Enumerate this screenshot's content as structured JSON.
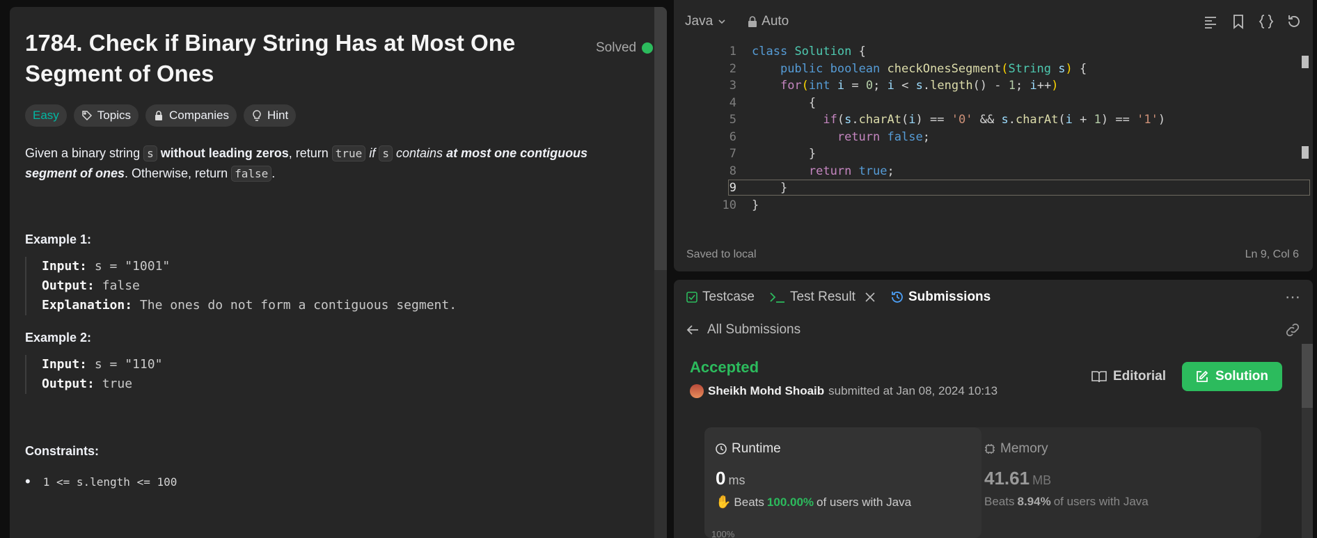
{
  "problem": {
    "title": "1784. Check if Binary String Has at Most One Segment of Ones",
    "status": "Solved",
    "tags": [
      "Easy",
      "Topics",
      "Companies",
      "Hint"
    ],
    "desc": {
      "p1": "Given a binary string ",
      "c1": "s",
      "b1": "without leading zeros",
      "p2": ", return ",
      "c2": "true",
      "i1": "if",
      "c3": "s",
      "i2": "contains",
      "b2": "at most one contiguous segment of ones",
      "p3": ". Otherwise, return ",
      "c4": "false",
      "p4": "."
    },
    "examples": [
      {
        "heading": "Example 1:",
        "input_label": "Input:",
        "input": "s = \"1001\"",
        "output_label": "Output:",
        "output": "false",
        "expl_label": "Explanation:",
        "expl": "The ones do not form a contiguous segment."
      },
      {
        "heading": "Example 2:",
        "input_label": "Input:",
        "input": "s = \"110\"",
        "output_label": "Output:",
        "output": "true"
      }
    ],
    "constraints_heading": "Constraints:",
    "constraint1": "1 <= s.length <= 100"
  },
  "editor": {
    "language": "Java",
    "mode": "Auto",
    "line_numbers": [
      "1",
      "2",
      "3",
      "4",
      "5",
      "6",
      "7",
      "8",
      "9",
      "10"
    ],
    "status_left": "Saved to local",
    "status_right": "Ln 9, Col 6"
  },
  "bottom": {
    "tabs": [
      "Testcase",
      "Test Result",
      "Submissions"
    ],
    "back_label": "All Submissions",
    "result": "Accepted",
    "author": "Sheikh Mohd Shoaib",
    "submitted": "submitted at Jan 08, 2024 10:13",
    "editorial_label": "Editorial",
    "solution_label": "Solution",
    "runtime": {
      "label": "Runtime",
      "value": "0",
      "unit": "ms",
      "beats_pre": "Beats",
      "beats_pct": "100.00%",
      "beats_post": "of users with Java"
    },
    "memory": {
      "label": "Memory",
      "value": "41.61",
      "unit": "MB",
      "beats_pre": "Beats",
      "beats_pct": "8.94%",
      "beats_post": "of users with Java"
    },
    "chart_tick": "100%"
  },
  "colors": {
    "easy": "#00b8a3",
    "accepted": "#2cbb5d",
    "solution_button": "#2cbb5d"
  }
}
